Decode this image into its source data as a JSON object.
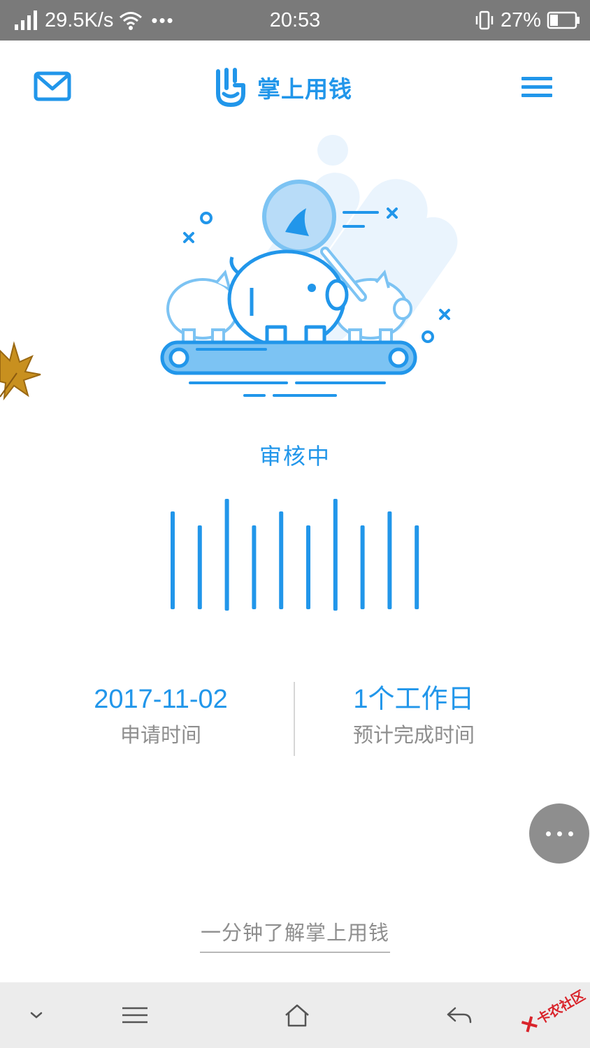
{
  "status_bar": {
    "network_speed": "29.5K/s",
    "time": "20:53",
    "battery": "27%",
    "icons": [
      "signal-icon",
      "wifi-icon",
      "more-dots-icon",
      "vibrate-icon",
      "battery-icon"
    ]
  },
  "header": {
    "brand_name": "掌上用钱",
    "left_icon": "mail-icon",
    "right_icon": "menu-icon",
    "accent_color": "#2196ea"
  },
  "review": {
    "status_text": "审核中",
    "progress_bars": 10
  },
  "info": {
    "apply_date": "2017-11-02",
    "apply_label": "申请时间",
    "estimate_value": "1个工作日",
    "estimate_label": "预计完成时间"
  },
  "floating_button": {
    "icon": "more-icon"
  },
  "footer_link": "一分钟了解掌上用钱",
  "nav_bar": {
    "buttons": [
      "collapse-icon",
      "menu-lines-icon",
      "home-icon",
      "back-icon"
    ]
  },
  "watermark": {
    "text": "卡农社区"
  }
}
